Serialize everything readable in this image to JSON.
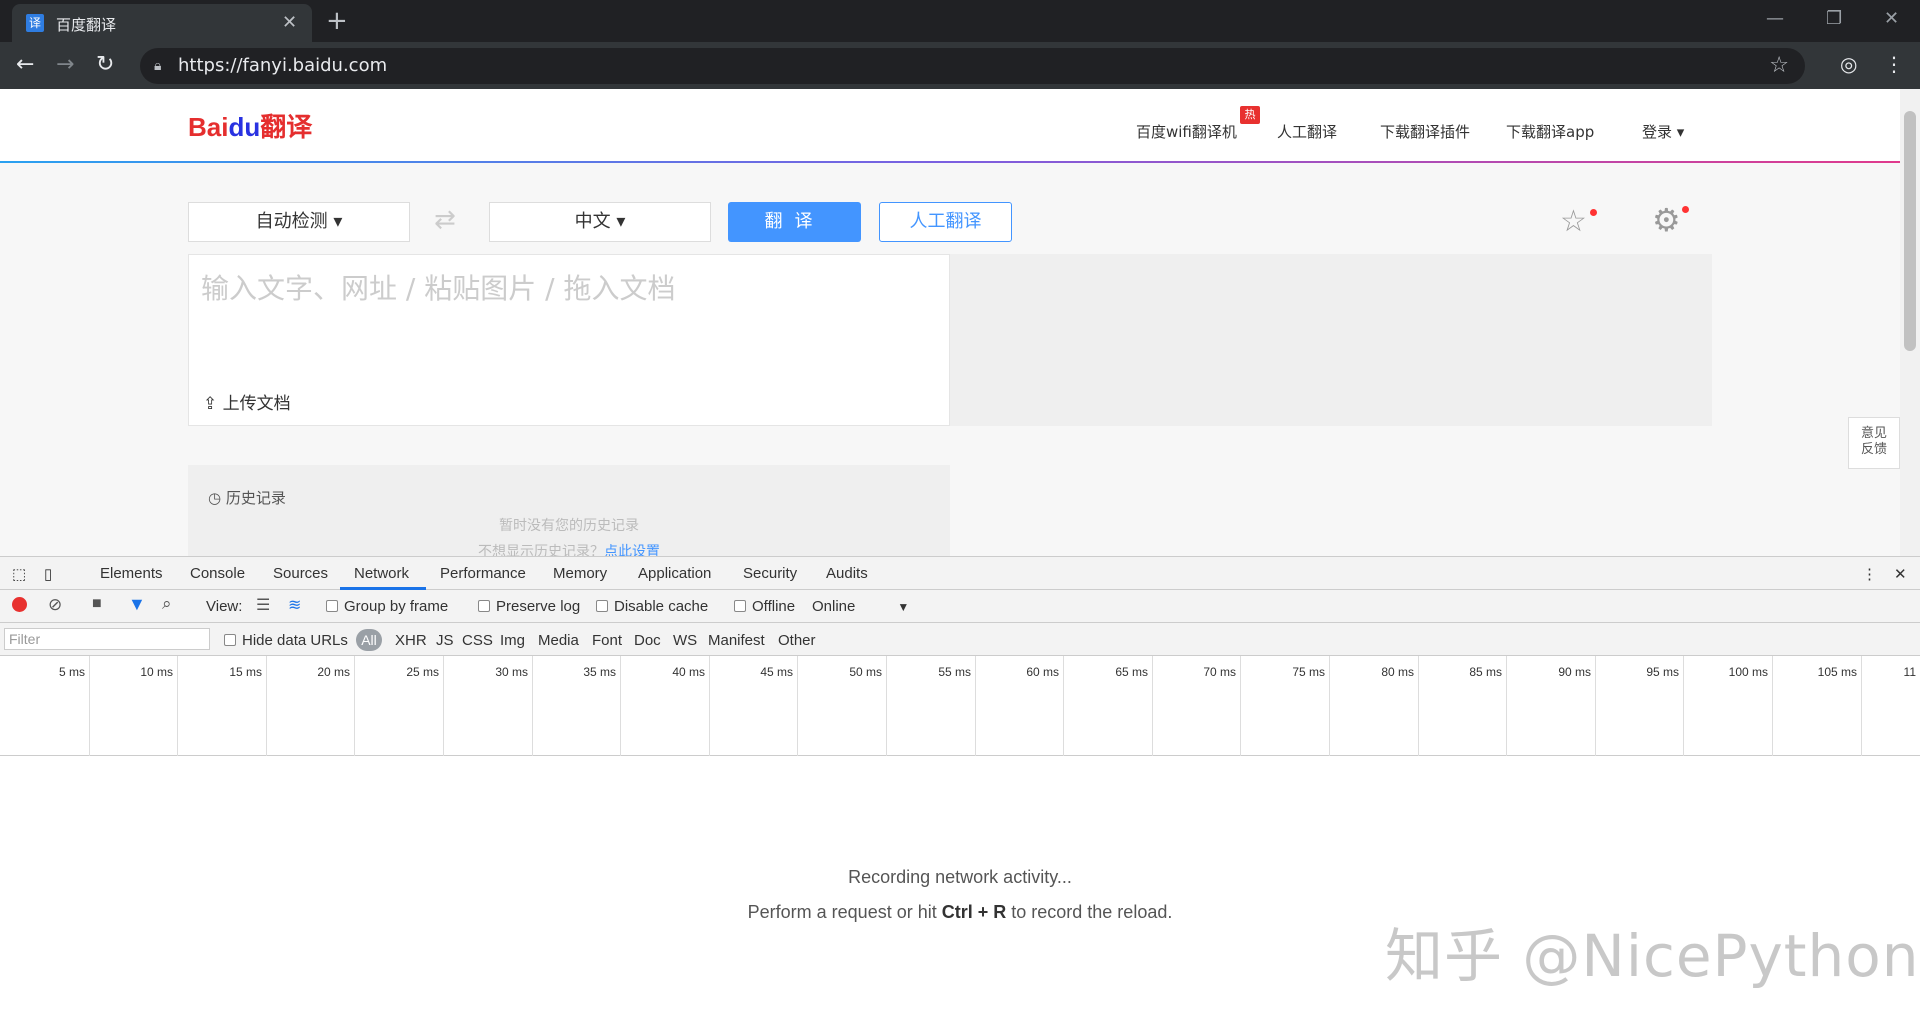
{
  "browser": {
    "tab_title": "百度翻译",
    "tab_favicon": "译",
    "url": "https://fanyi.baidu.com"
  },
  "site": {
    "logo_text_a": "Bai",
    "logo_text_b": "du",
    "logo_text_c": "翻译",
    "nav": [
      "百度wifi翻译机",
      "人工翻译",
      "下载翻译插件",
      "下载翻译app",
      "登录 ▾"
    ],
    "hot_badge": "热",
    "source_lang": "自动检测 ▾",
    "target_lang": "中文 ▾",
    "translate_btn": "翻译",
    "human_btn": "人工翻译",
    "input_placeholder": "输入文字、网址 / 粘贴图片 / 拖入文档",
    "upload_doc": "上传文档",
    "history_title": "历史记录",
    "history_empty": "暂时没有您的历史记录",
    "history_hint": "不想显示历史记录？",
    "history_hint_link": "点此设置",
    "feedback_line1": "意见",
    "feedback_line2": "反馈"
  },
  "devtools": {
    "tabs": [
      "Elements",
      "Console",
      "Sources",
      "Network",
      "Performance",
      "Memory",
      "Application",
      "Security",
      "Audits"
    ],
    "active_tab": "Network",
    "toolbar": {
      "view_label": "View:",
      "group_by_frame": "Group by frame",
      "preserve_log": "Preserve log",
      "disable_cache": "Disable cache",
      "offline": "Offline",
      "throttle": "Online"
    },
    "filter_placeholder": "Filter",
    "hide_data_urls": "Hide data URLs",
    "filters": [
      "All",
      "XHR",
      "JS",
      "CSS",
      "Img",
      "Media",
      "Font",
      "Doc",
      "WS",
      "Manifest",
      "Other"
    ],
    "ticks": [
      "5 ms",
      "10 ms",
      "15 ms",
      "20 ms",
      "25 ms",
      "30 ms",
      "35 ms",
      "40 ms",
      "45 ms",
      "50 ms",
      "55 ms",
      "60 ms",
      "65 ms",
      "70 ms",
      "75 ms",
      "80 ms",
      "85 ms",
      "90 ms",
      "95 ms",
      "100 ms",
      "105 ms",
      "11"
    ],
    "recording": "Recording network activity...",
    "hint_pre": "Perform a request or hit ",
    "hint_key": "Ctrl + R",
    "hint_post": " to record the reload."
  },
  "watermark": "知乎 @NicePython",
  "colors": {
    "accent": "#4395ff",
    "record": "#e8312f",
    "devtools_active": "#1a73e8"
  }
}
